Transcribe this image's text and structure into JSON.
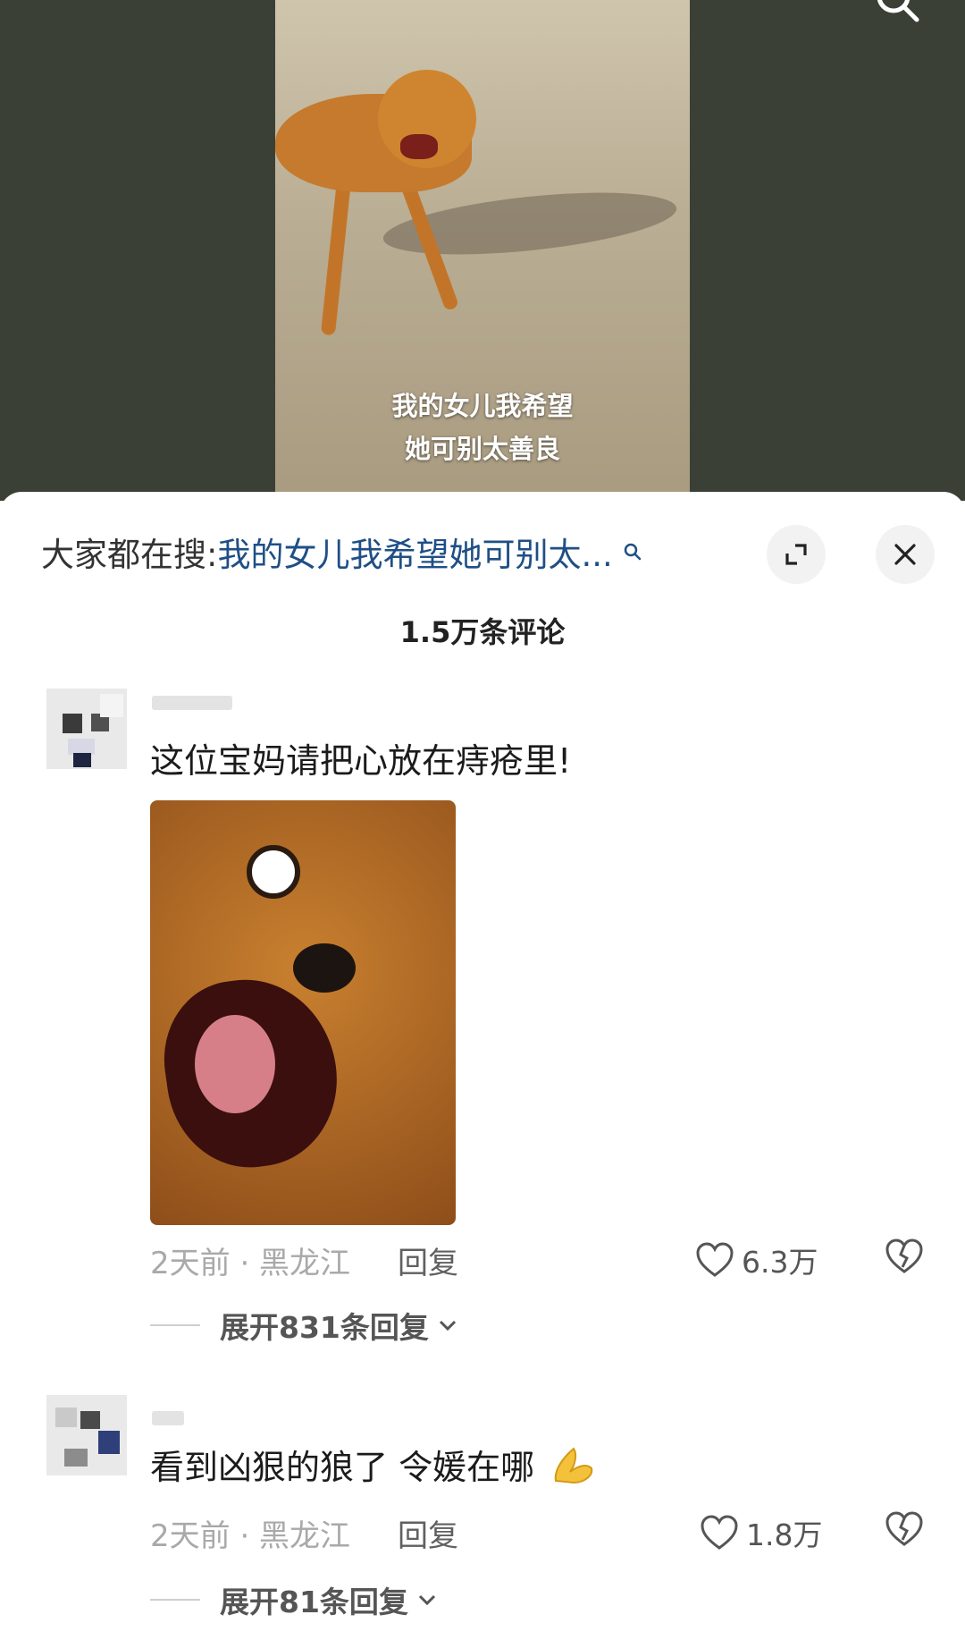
{
  "video": {
    "caption_lines": [
      "我的女儿我希望",
      "她可别太善良"
    ]
  },
  "search": {
    "prefix": "大家都在搜:",
    "query": "我的女儿我希望她可别太..."
  },
  "comment_count": "1.5万条评论",
  "comments": [
    {
      "text": "这位宝妈请把心放在痔疮里!",
      "meta": "2天前 · 黑龙江",
      "reply_label": "回复",
      "likes": "6.3万",
      "expand_label": "展开831条回复"
    },
    {
      "text": "看到凶狠的狼了 令媛在哪",
      "meta": "2天前 · 黑龙江",
      "reply_label": "回复",
      "likes": "1.8万",
      "expand_label": "展开81条回复"
    }
  ],
  "icons": {
    "search": "search-icon",
    "expand": "expand-icon",
    "close": "close-icon",
    "like": "heart-icon",
    "dislike": "broken-heart-icon",
    "chevron": "chevron-down-icon",
    "emoji": "praying-hands-emoji"
  },
  "colors": {
    "search_query": "#1f4f86",
    "meta_text": "#a9a9a9",
    "video_bg": "#3a4036"
  }
}
